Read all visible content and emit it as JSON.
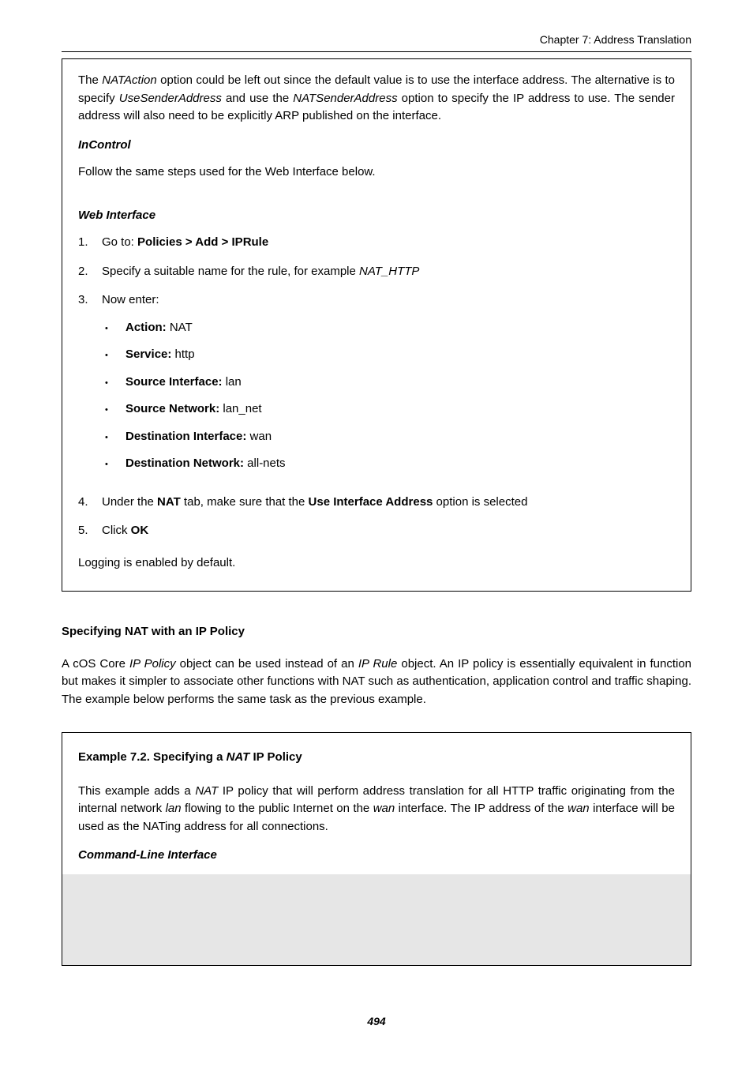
{
  "header": {
    "chapter": "Chapter 7: Address Translation"
  },
  "box1": {
    "intro_1": "The ",
    "intro_nataction": "NATAction",
    "intro_2": " option could be left out since the default value is to use the interface address. The alternative is to specify ",
    "intro_usesender": "UseSenderAddress",
    "intro_3": " and use the ",
    "intro_natsender": "NATSenderAddress",
    "intro_4": " option to specify the IP address to use. The sender address will also need to be explicitly ARP published on the interface.",
    "incontrol_label": "InControl",
    "incontrol_text": "Follow the same steps used for the Web Interface below.",
    "webif_label": "Web Interface",
    "step1_a": "Go to: ",
    "step1_b": "Policies > Add > IPRule",
    "step2_a": "Specify a suitable name for the rule, for example ",
    "step2_b": "NAT_HTTP",
    "step3_a": "Now enter:",
    "bullets": {
      "action_l": "Action:",
      "action_v": " NAT",
      "service_l": "Service:",
      "service_v": " http",
      "srcif_l": "Source Interface:",
      "srcif_v": " lan",
      "srcnet_l": "Source Network:",
      "srcnet_v": " lan_net",
      "dstif_l": "Destination Interface:",
      "dstif_v": " wan",
      "dstnet_l": "Destination Network:",
      "dstnet_v": " all-nets"
    },
    "step4_a": "Under the ",
    "step4_b": "NAT",
    "step4_c": " tab, make sure that the ",
    "step4_d": "Use Interface Address",
    "step4_e": " option is selected",
    "step5_a": "Click ",
    "step5_b": "OK",
    "logging": "Logging is enabled by default."
  },
  "section": {
    "title": "Specifying NAT with an IP Policy",
    "p1_a": "A cOS Core ",
    "p1_b": "IP Policy",
    "p1_c": " object can be used instead of an ",
    "p1_d": "IP Rule",
    "p1_e": " object. An IP policy is essentially equivalent in function but makes it simpler to associate other functions with NAT such as authentication, application control and traffic shaping. The example below performs the same task as the previous example."
  },
  "box2": {
    "title_a": "Example 7.2. Specifying a ",
    "title_b": "NAT",
    "title_c": " IP Policy",
    "p1_a": "This example adds a ",
    "p1_b": "NAT",
    "p1_c": " IP policy that will perform address translation for all HTTP traffic originating from the internal network ",
    "p1_d": "lan",
    "p1_e": " flowing to the public Internet on the ",
    "p1_f": "wan",
    "p1_g": " interface. The IP address of the ",
    "p1_h": "wan",
    "p1_i": " interface will be used as the NATing address for all connections.",
    "cli_label": "Command-Line Interface"
  },
  "page_number": "494"
}
